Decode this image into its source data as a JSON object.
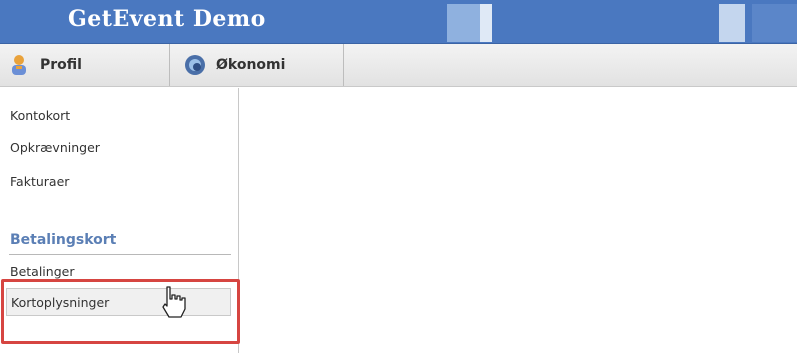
{
  "header": {
    "title": "GetEvent Demo"
  },
  "tabs": [
    {
      "label": "Profil",
      "icon": "user-icon"
    },
    {
      "label": "Økonomi",
      "icon": "swirl-icon"
    }
  ],
  "sidebar": {
    "items": [
      {
        "label": "Kontokort"
      },
      {
        "label": "Opkrævninger"
      },
      {
        "label": "Fakturaer"
      }
    ],
    "section": {
      "title": "Betalingskort",
      "items": [
        {
          "label": "Betalinger"
        },
        {
          "label": "Kortoplysninger"
        }
      ]
    }
  },
  "colors": {
    "header_bg": "#4a78c0",
    "section_title": "#5b7fb5",
    "highlight": "#d64541"
  }
}
